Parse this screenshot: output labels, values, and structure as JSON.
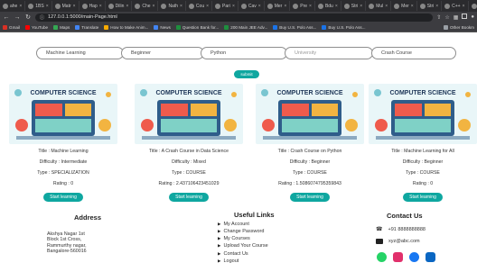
{
  "browser": {
    "tabs": [
      {
        "label": "ahe",
        "active": false
      },
      {
        "label": "1BS",
        "active": false
      },
      {
        "label": "Matr",
        "active": false
      },
      {
        "label": "Hap",
        "active": false
      },
      {
        "label": "Dilin",
        "active": false
      },
      {
        "label": "Che",
        "active": false
      },
      {
        "label": "Nath",
        "active": false
      },
      {
        "label": "Cou",
        "active": false
      },
      {
        "label": "Pari",
        "active": false
      },
      {
        "label": "Cav",
        "active": false
      },
      {
        "label": "Mer",
        "active": false
      },
      {
        "label": "Pre",
        "active": false
      },
      {
        "label": "Bdu",
        "active": false
      },
      {
        "label": "Stri",
        "active": false
      },
      {
        "label": "Mul",
        "active": false
      },
      {
        "label": "Mer",
        "active": false
      },
      {
        "label": "Stri",
        "active": false
      },
      {
        "label": "C++",
        "active": false
      },
      {
        "label": "Gr",
        "active": false
      },
      {
        "label": "Lt",
        "active": true
      }
    ],
    "url": "127.0.0.1:5000/main-Page.html",
    "bookmarks": [
      "Gmail",
      "YouTube",
      "Maps",
      "Translate",
      "How to Make Anim...",
      "News",
      "Question Bank for...",
      "200 Main JEE Adv...",
      "Buy U.S. Polo Ass...",
      "Buy U.S. Polo Ass..."
    ],
    "other_bookmarks": "Other Bookm"
  },
  "search": {
    "fields": [
      "Machine Learning",
      "Beginner",
      "Python",
      "University",
      "Crash Course"
    ],
    "submit_label": "submit"
  },
  "cards": [
    {
      "image_text": "COMPUTER SCIENCE",
      "title": "Title : Machine Learning",
      "difficulty": "Difficulty : Intermediate",
      "type": "Type : SPECIALIZATION",
      "rating": "Rating : 0",
      "button": "Start learning"
    },
    {
      "image_text": "COMPUTER SCIENCE",
      "title": "Title : A Crash Course in Data Science",
      "difficulty": "Difficulty : Mixed",
      "type": "Type : COURSE",
      "rating": "Rating : 2.437106423451029",
      "button": "Start learning"
    },
    {
      "image_text": "COMPUTER SCIENCE",
      "title": "Title : Crash Course on Python",
      "difficulty": "Difficulty : Beginner",
      "type": "Type : COURSE",
      "rating": "Rating : 1.5086074795359843",
      "button": "Start learning"
    },
    {
      "image_text": "COMPUTER SCIENCE",
      "title": "Title : Machine Learning for All",
      "difficulty": "Difficulty : Beginner",
      "type": "Type : COURSE",
      "rating": "Rating : 0",
      "button": "Start learning"
    }
  ],
  "footer": {
    "address": {
      "heading": "Address",
      "lines": [
        "Akshya Nagar 1st",
        "Block 1st Cross,",
        "Rammurthy nagar,",
        "Bangalore-560016"
      ]
    },
    "links": {
      "heading": "Useful Links",
      "items": [
        "My Account",
        "Change Password",
        "My Courses",
        "Upload Your Course",
        "Contact Us",
        "Logout"
      ]
    },
    "contact": {
      "heading": "Contact Us",
      "phone": "+91 8888888888",
      "email": "xyz@abc.com"
    }
  },
  "colors": {
    "accent": "#0fa7a0",
    "whatsapp": "#25d366",
    "instagram": "#e1306c",
    "facebook": "#1877f2",
    "linkedin": "#0a66c2"
  }
}
